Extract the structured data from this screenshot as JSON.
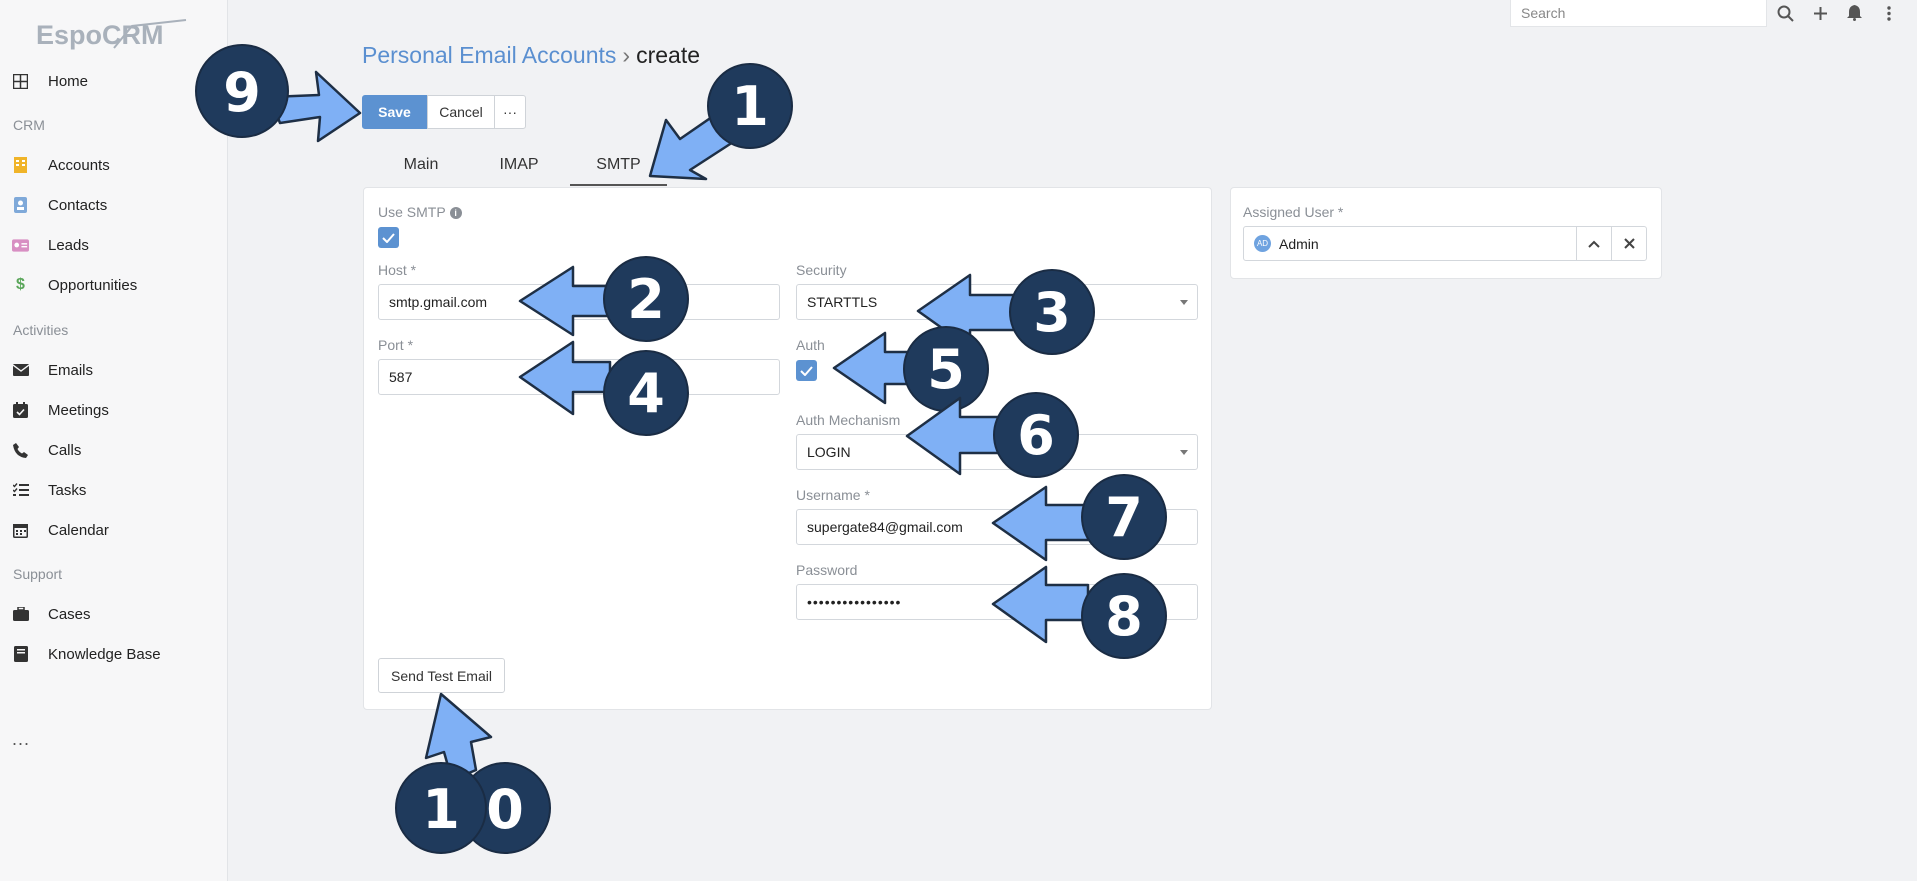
{
  "app": {
    "logo_text": "EspoCRM"
  },
  "header": {
    "search_placeholder": "Search"
  },
  "sidebar": {
    "home": "Home",
    "group_crm": "CRM",
    "accounts": "Accounts",
    "contacts": "Contacts",
    "leads": "Leads",
    "opportunities": "Opportunities",
    "group_activities": "Activities",
    "emails": "Emails",
    "meetings": "Meetings",
    "calls": "Calls",
    "tasks": "Tasks",
    "calendar": "Calendar",
    "group_support": "Support",
    "cases": "Cases",
    "knowledge_base": "Knowledge Base",
    "more": "..."
  },
  "breadcrumb": {
    "parent": "Personal Email Accounts",
    "separator": "›",
    "current": "create"
  },
  "actions": {
    "save": "Save",
    "cancel": "Cancel",
    "more": "···"
  },
  "tabs": {
    "main": "Main",
    "imap": "IMAP",
    "smtp": "SMTP",
    "active": "SMTP"
  },
  "form": {
    "use_smtp_label": "Use SMTP",
    "use_smtp_checked": true,
    "host_label": "Host *",
    "host_value": "smtp.gmail.com",
    "port_label": "Port *",
    "port_value": "587",
    "security_label": "Security",
    "security_value": "STARTTLS",
    "auth_label": "Auth",
    "auth_checked": true,
    "auth_mechanism_label": "Auth Mechanism",
    "auth_mechanism_value": "LOGIN",
    "username_label": "Username *",
    "username_value": "supergate84@gmail.com",
    "password_label": "Password",
    "password_value": "••••••••••••••••",
    "send_test_email": "Send Test Email"
  },
  "assigned": {
    "label": "Assigned User *",
    "avatar_initials": "AD",
    "value": "Admin"
  },
  "annotations": {
    "n1": "1",
    "n2": "2",
    "n3": "3",
    "n4": "4",
    "n5": "5",
    "n6": "6",
    "n7": "7",
    "n8": "8",
    "n9": "9",
    "n10a": "1",
    "n10b": "0"
  },
  "colors": {
    "accent": "#5c92d1",
    "annotation_circle": "#1f3a5c",
    "annotation_arrow": "#7fb0f5"
  }
}
